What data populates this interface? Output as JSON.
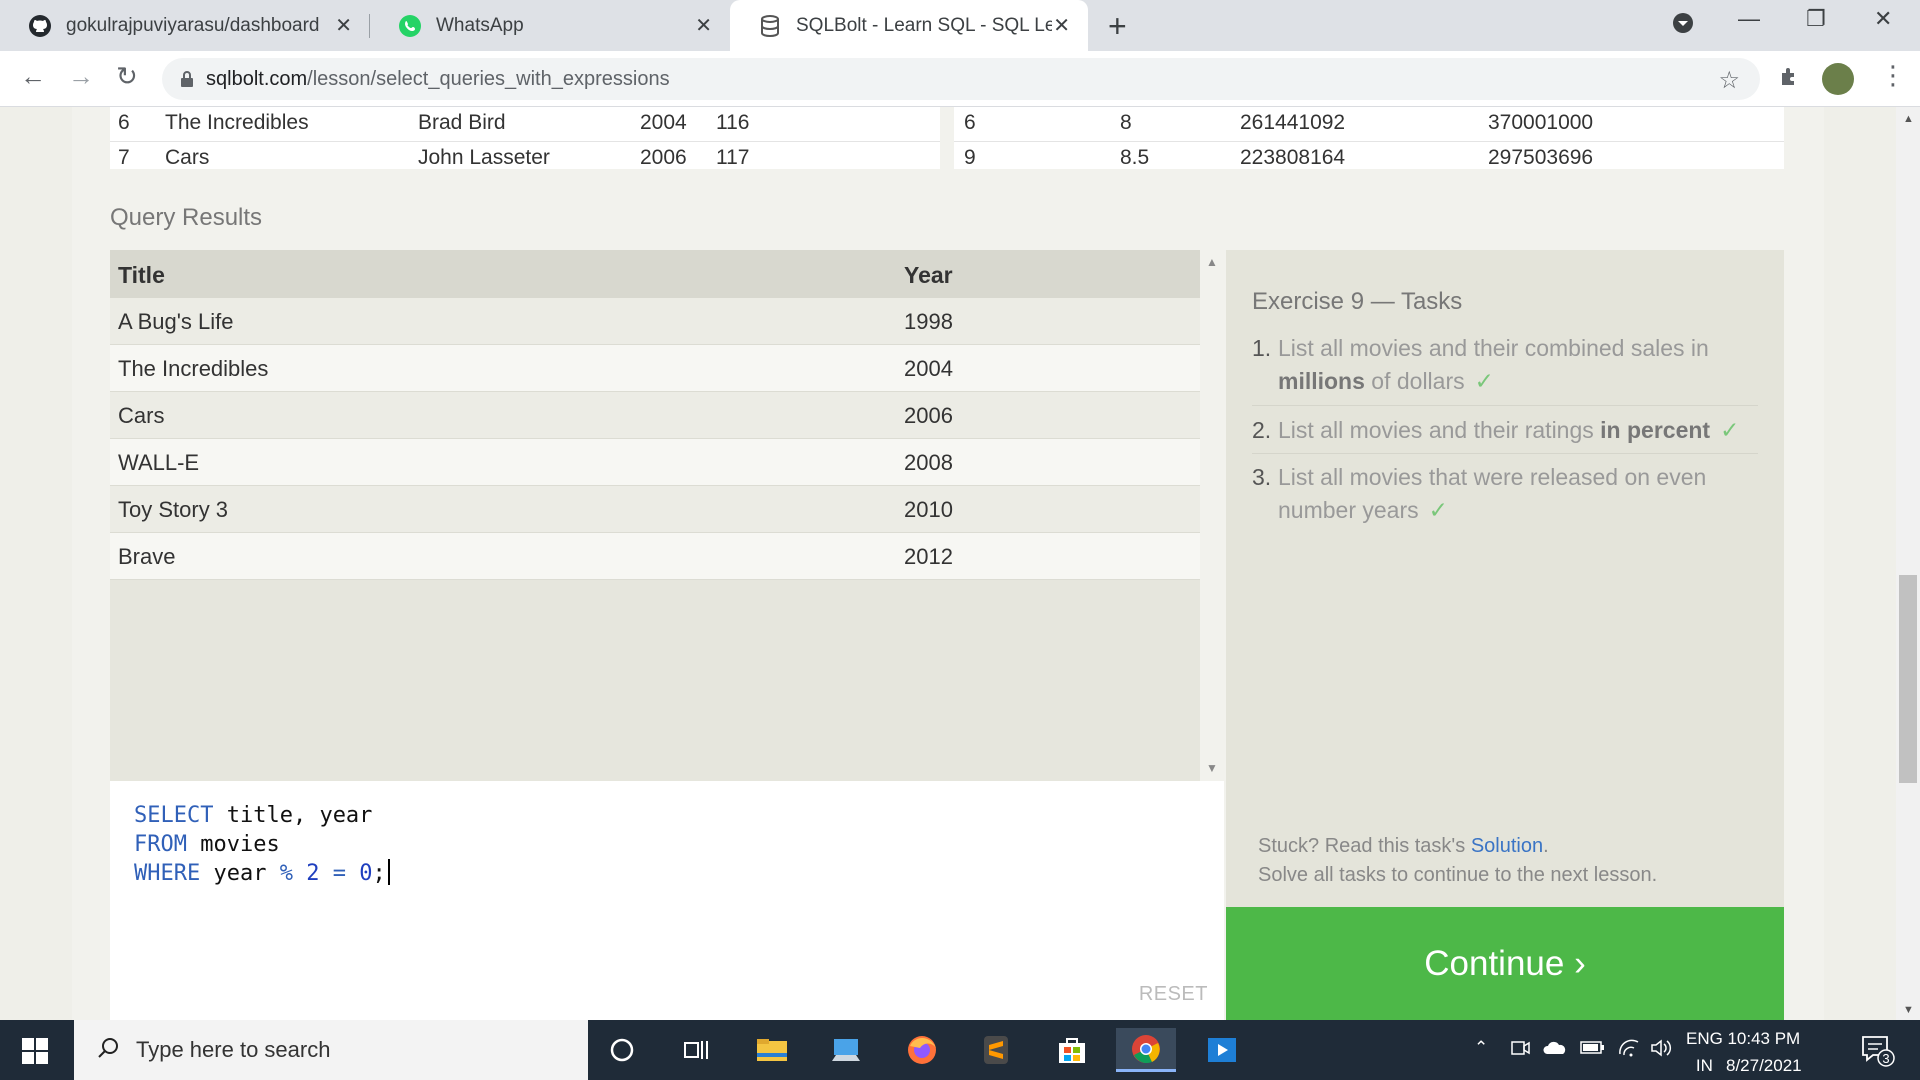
{
  "browser": {
    "tabs": [
      {
        "label": "gokulrajpuviyarasu/dashboard",
        "icon": "github-icon",
        "active": false
      },
      {
        "label": "WhatsApp",
        "icon": "whatsapp-icon",
        "active": false
      },
      {
        "label": "SQLBolt - Learn SQL - SQL Lesson",
        "icon": "database-icon",
        "active": true
      }
    ],
    "url_host": "sqlbolt.com",
    "url_path": "/lesson/select_queries_with_expressions"
  },
  "top_table": {
    "left_rows": [
      {
        "id": "6",
        "title": "The Incredibles",
        "director": "Brad Bird",
        "year": "2004",
        "length": "116"
      },
      {
        "id": "7",
        "title": "Cars",
        "director": "John Lasseter",
        "year": "2006",
        "length": "117"
      }
    ],
    "right_rows": [
      {
        "movie_id": "6",
        "rating": "8",
        "domestic": "261441092",
        "international": "370001000"
      },
      {
        "movie_id": "9",
        "rating": "8.5",
        "domestic": "223808164",
        "international": "297503696"
      }
    ]
  },
  "results": {
    "label": "Query Results",
    "columns": [
      "Title",
      "Year"
    ],
    "rows": [
      {
        "title": "A Bug's Life",
        "year": "1998"
      },
      {
        "title": "The Incredibles",
        "year": "2004"
      },
      {
        "title": "Cars",
        "year": "2006"
      },
      {
        "title": "WALL-E",
        "year": "2008"
      },
      {
        "title": "Toy Story 3",
        "year": "2010"
      },
      {
        "title": "Brave",
        "year": "2012"
      }
    ]
  },
  "editor": {
    "line1_kw": "SELECT",
    "line1_rest": " title, year",
    "line2_kw": "FROM",
    "line2_rest": " movies",
    "line3_kw": "WHERE",
    "line3_a": " year ",
    "line3_op": "%",
    "line3_b": " ",
    "line3_n1": "2",
    "line3_c": " ",
    "line3_eq": "=",
    "line3_d": " ",
    "line3_n2": "0",
    "line3_end": ";",
    "reset_label": "RESET"
  },
  "tasks": {
    "title": "Exercise 9 — Tasks",
    "items": [
      {
        "num": "1.",
        "pre": "List all movies and their combined sales in ",
        "bold": "millions",
        "post": " of dollars",
        "check": "✓"
      },
      {
        "num": "2.",
        "pre": "List all movies and their ratings ",
        "bold": "in percent",
        "post": "",
        "check": "✓"
      },
      {
        "num": "3.",
        "pre": "List all movies that were released on even number years",
        "bold": "",
        "post": "",
        "check": "✓"
      }
    ],
    "stuck_pre": "Stuck? Read this task's ",
    "stuck_link": "Solution",
    "stuck_post": ".",
    "solve_text": "Solve all tasks to continue to the next lesson.",
    "continue_label": "Continue ›"
  },
  "taskbar": {
    "search_placeholder": "Type here to search",
    "lang_top": "ENG",
    "lang_bottom": "IN",
    "time": "10:43 PM",
    "date": "8/27/2021",
    "notifications": "3"
  },
  "colors": {
    "continue": "#4db848",
    "keyword": "#3060b8",
    "link": "#3a74c5"
  }
}
